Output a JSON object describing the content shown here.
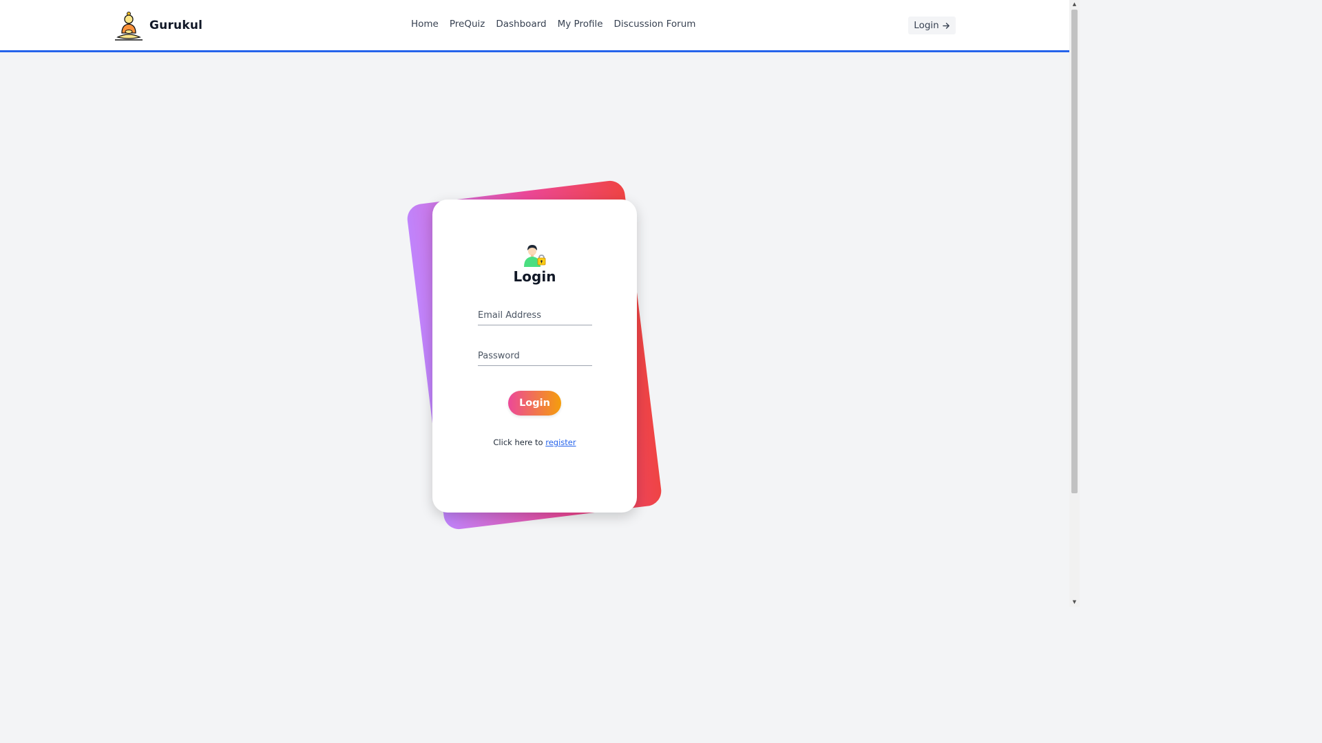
{
  "header": {
    "brand_name": "Gurukul",
    "brand_icon": "meditating-monk-logo",
    "nav": [
      {
        "label": "Home"
      },
      {
        "label": "PreQuiz"
      },
      {
        "label": "Dashboard"
      },
      {
        "label": "My Profile"
      },
      {
        "label": "Discussion Forum"
      }
    ],
    "login_button": {
      "label": "Login",
      "icon": "arrow-right-icon"
    }
  },
  "login_card": {
    "icon": "user-lock-icon",
    "title": "Login",
    "email_placeholder": "Email Address",
    "email_value": "",
    "password_placeholder": "Password",
    "password_value": "",
    "submit_label": "Login",
    "register_prefix": "Click here to ",
    "register_link": "register"
  },
  "colors": {
    "accent_border": "#2563eb",
    "page_background": "#f3f4f6",
    "back_card_gradient": [
      "#c084fc",
      "#ec4899",
      "#ef4444"
    ],
    "button_gradient": [
      "#ec4899",
      "#f59e0b"
    ],
    "link": "#2563eb"
  }
}
